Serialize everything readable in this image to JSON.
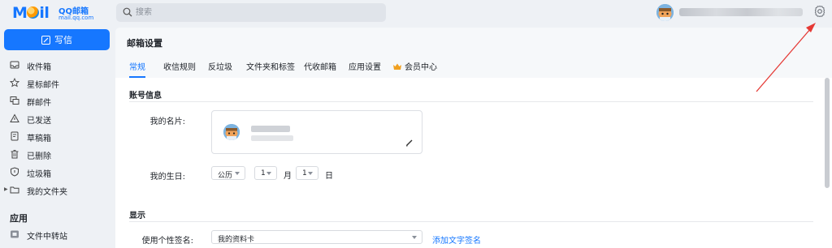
{
  "app": {
    "logo_main": "M",
    "logo_main_tail": "il",
    "logo_product": "QQ邮箱",
    "logo_domain": "mail.qq.com"
  },
  "search": {
    "placeholder": "搜索",
    "icon": "search-icon"
  },
  "header": {
    "settings_icon": "gear-icon"
  },
  "sidebar": {
    "compose_label": "写信",
    "items": [
      {
        "label": "收件箱",
        "icon": "inbox-icon"
      },
      {
        "label": "星标邮件",
        "icon": "star-icon"
      },
      {
        "label": "群邮件",
        "icon": "group-mail-icon"
      },
      {
        "label": "已发送",
        "icon": "sent-icon"
      },
      {
        "label": "草稿箱",
        "icon": "draft-icon"
      },
      {
        "label": "已删除",
        "icon": "trash-icon"
      },
      {
        "label": "垃圾箱",
        "icon": "spam-shield-icon"
      },
      {
        "label": "我的文件夹",
        "icon": "folder-icon"
      }
    ],
    "apps_title": "应用",
    "apps": [
      {
        "label": "文件中转站",
        "icon": "file-transfer-icon"
      }
    ]
  },
  "settings": {
    "title": "邮箱设置",
    "tabs": [
      "常规",
      "收信规则",
      "反垃圾",
      "文件夹和标签",
      "代收邮箱",
      "应用设置",
      "会员中心"
    ],
    "active_tab": "常规",
    "account_section": "账号信息",
    "card_label": "我的名片:",
    "birthday_label": "我的生日:",
    "calendar_value": "公历",
    "month_value": "1",
    "month_unit": "月",
    "day_value": "1",
    "day_unit": "日",
    "display_section": "显示",
    "signature_label": "使用个性签名:",
    "signature_value": "我的资料卡",
    "add_signature_link": "添加文字签名"
  },
  "colors": {
    "accent": "#1677ff",
    "annotation_arrow": "#e53935"
  }
}
